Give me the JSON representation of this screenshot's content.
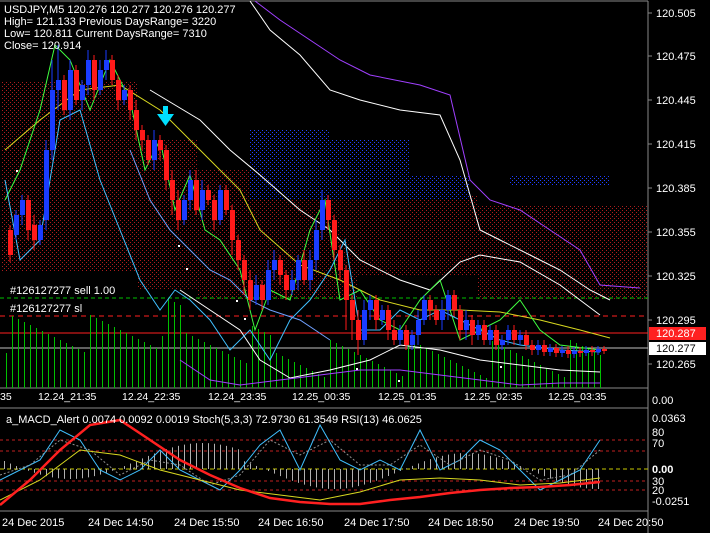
{
  "header": {
    "line1": "USDJPY,M5  120.276 120.277 120.276 120.277",
    "line2": "High= 121.133 Previous DaysRange= 3220",
    "line3": "Low= 120.811 Current DaysRange= 7310",
    "line4": "Close= 120.914"
  },
  "orders": {
    "sell": "#126127277 sell 1.00",
    "sl": "#126127277 sl"
  },
  "price_axis": {
    "labels": [
      "120.505",
      "120.475",
      "120.445",
      "120.415",
      "120.385",
      "120.355",
      "120.325",
      "120.295",
      "120.265"
    ],
    "red_box": "120.287",
    "white_box": "120.277"
  },
  "time_axis_main": [
    "35",
    "12.24_21:35",
    "12.24_22:35",
    "12.24_23:35",
    "12.25_00:35",
    "12.25_01:35",
    "12.25_02:35",
    "12.25_03:35"
  ],
  "indicator": {
    "title": "a_MACD_Alert  0.0074  0.0092  0.0019  Stoch(5,3,3) 72.9730 61.3549  RSI(13) 46.0625",
    "axis_labels": [
      "0.0363",
      "80",
      "70",
      "0.00",
      "30",
      "20",
      "-0.0251"
    ],
    "zero_label_top": "0.00"
  },
  "bottom_axis": [
    "24 Dec 2015",
    "24 Dec 14:50",
    "24 Dec 15:50",
    "24 Dec 16:50",
    "24 Dec 17:50",
    "24 Dec 18:50",
    "24 Dec 19:50",
    "24 Dec 20:50"
  ],
  "colors": {
    "background": "#000000",
    "bull_candle": "#1a3cff",
    "bear_candle": "#ff1a1a",
    "cloud_bull": "#2040ff",
    "cloud_bear": "#c02020",
    "arrow": "#00e0ff",
    "macd_signal": "#ff2020",
    "grid_yellow": "#c8c800",
    "green": "#00c000"
  },
  "icons": {
    "signal_arrow": "down-arrow-icon"
  }
}
